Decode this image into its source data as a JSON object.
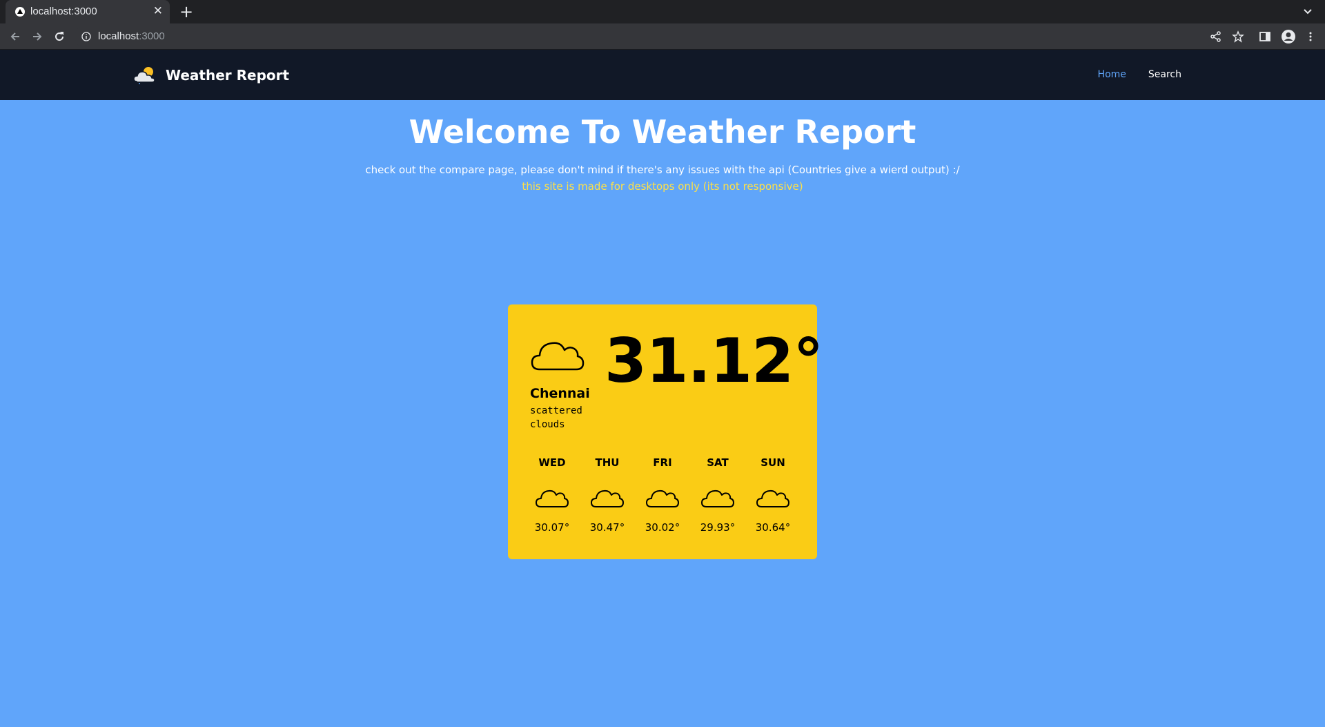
{
  "browser": {
    "tab_title": "localhost:3000",
    "url_host": "localhost",
    "url_port": ":3000"
  },
  "site": {
    "brand_name": "Weather Report",
    "nav": {
      "home": "Home",
      "search": "Search"
    }
  },
  "hero": {
    "title": "Welcome To Weather Report",
    "subtitle": "check out the compare page, please don't mind if there's any issues with the api (Countries give a wierd output) :/",
    "note": "this site is made for desktops only (its not responsive)"
  },
  "weather": {
    "icon": "cloud-icon",
    "temperature": "31.12°",
    "city": "Chennai",
    "description": "scattered clouds",
    "forecast": [
      {
        "day": "WED",
        "icon": "cloud-icon",
        "temp": "30.07°"
      },
      {
        "day": "THU",
        "icon": "cloud-icon",
        "temp": "30.47°"
      },
      {
        "day": "FRI",
        "icon": "cloud-icon",
        "temp": "30.02°"
      },
      {
        "day": "SAT",
        "icon": "cloud-icon",
        "temp": "29.93°"
      },
      {
        "day": "SUN",
        "icon": "cloud-icon",
        "temp": "30.64°"
      }
    ]
  },
  "colors": {
    "page_bg": "#60a5fa",
    "header_bg": "#111827",
    "card_bg": "#facc15",
    "note": "#fde047",
    "nav_active": "#60a5fa"
  }
}
